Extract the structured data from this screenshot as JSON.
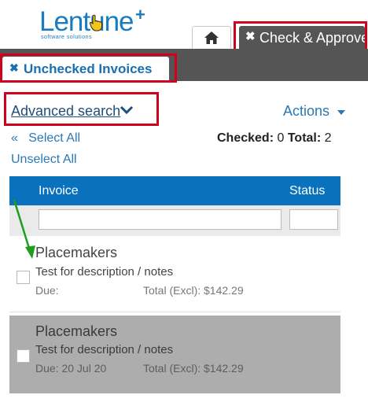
{
  "brand": {
    "name": "Lentune",
    "plus": "+",
    "tagline": "software solutions"
  },
  "tabs": {
    "home_icon": "home-icon",
    "check_approve": {
      "close": "✖",
      "label": "Check & Approve"
    }
  },
  "subtab": {
    "close": "✖",
    "label": "Unchecked Invoices"
  },
  "toolbar": {
    "advanced_search": "Advanced search",
    "actions": "Actions",
    "select_all_glyph": "«",
    "select_all": "Select All",
    "unselect_all": "Unselect All",
    "checked_label": "Checked:",
    "checked_value": "0",
    "total_label": "Total:",
    "total_value": "2"
  },
  "table": {
    "columns": [
      "Invoice",
      "Status"
    ],
    "rows": [
      {
        "supplier": "Placemakers",
        "description": "Test for description / notes",
        "due_label": "Due:",
        "due_date": "",
        "total_label": "Total (Excl):",
        "total": "$142.29",
        "checked": false,
        "highlighted": false
      },
      {
        "supplier": "Placemakers",
        "description": "Test for description / notes",
        "due_label": "Due:",
        "due_date": "20 Jul 20",
        "total_label": "Total (Excl):",
        "total": "$142.29",
        "checked": false,
        "highlighted": true
      }
    ]
  },
  "colors": {
    "accent": "#0a72bd",
    "dark_bar": "#555555",
    "highlight_box": "#d0021b",
    "annotation_arrow": "#1f9d1f",
    "selected_row": "#adadad"
  }
}
